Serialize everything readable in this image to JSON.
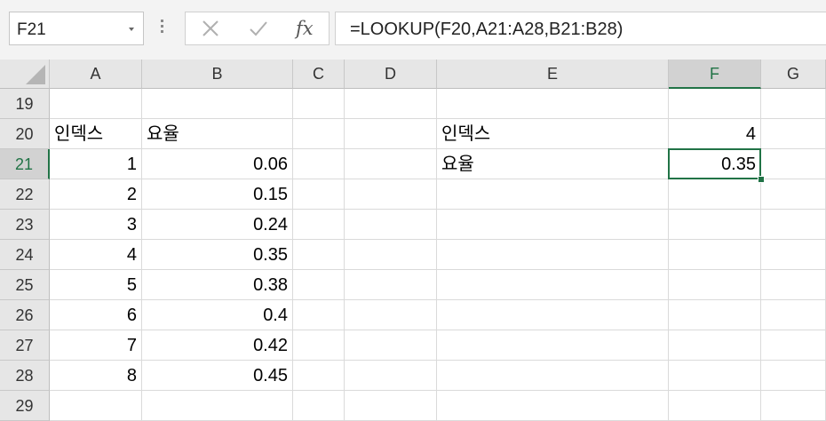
{
  "name_box": {
    "value": "F21"
  },
  "formula_bar": {
    "formula": "=LOOKUP(F20,A21:A28,B21:B28)",
    "fx_label": "fx"
  },
  "columns": [
    {
      "label": "A",
      "width": 0
    },
    {
      "label": "B"
    },
    {
      "label": "C"
    },
    {
      "label": "D"
    },
    {
      "label": "E"
    },
    {
      "label": "F"
    },
    {
      "label": "G"
    }
  ],
  "rows": [
    {
      "num": "19",
      "A": "",
      "B": "",
      "E": "",
      "F": ""
    },
    {
      "num": "20",
      "A": "인덱스",
      "B": "요율",
      "E": "인덱스",
      "F": "4"
    },
    {
      "num": "21",
      "A": "1",
      "B": "0.06",
      "E": "요율",
      "F": "0.35"
    },
    {
      "num": "22",
      "A": "2",
      "B": "0.15",
      "E": "",
      "F": ""
    },
    {
      "num": "23",
      "A": "3",
      "B": "0.24",
      "E": "",
      "F": ""
    },
    {
      "num": "24",
      "A": "4",
      "B": "0.35",
      "E": "",
      "F": ""
    },
    {
      "num": "25",
      "A": "5",
      "B": "0.38",
      "E": "",
      "F": ""
    },
    {
      "num": "26",
      "A": "6",
      "B": "0.4",
      "E": "",
      "F": ""
    },
    {
      "num": "27",
      "A": "7",
      "B": "0.42",
      "E": "",
      "F": ""
    },
    {
      "num": "28",
      "A": "8",
      "B": "0.45",
      "E": "",
      "F": ""
    },
    {
      "num": "29",
      "A": "",
      "B": "",
      "E": "",
      "F": ""
    }
  ],
  "selection": {
    "column": "F",
    "row": "21"
  },
  "colors": {
    "accent": "#217346",
    "header_bg": "#e6e6e6",
    "gridline": "#dadada"
  }
}
